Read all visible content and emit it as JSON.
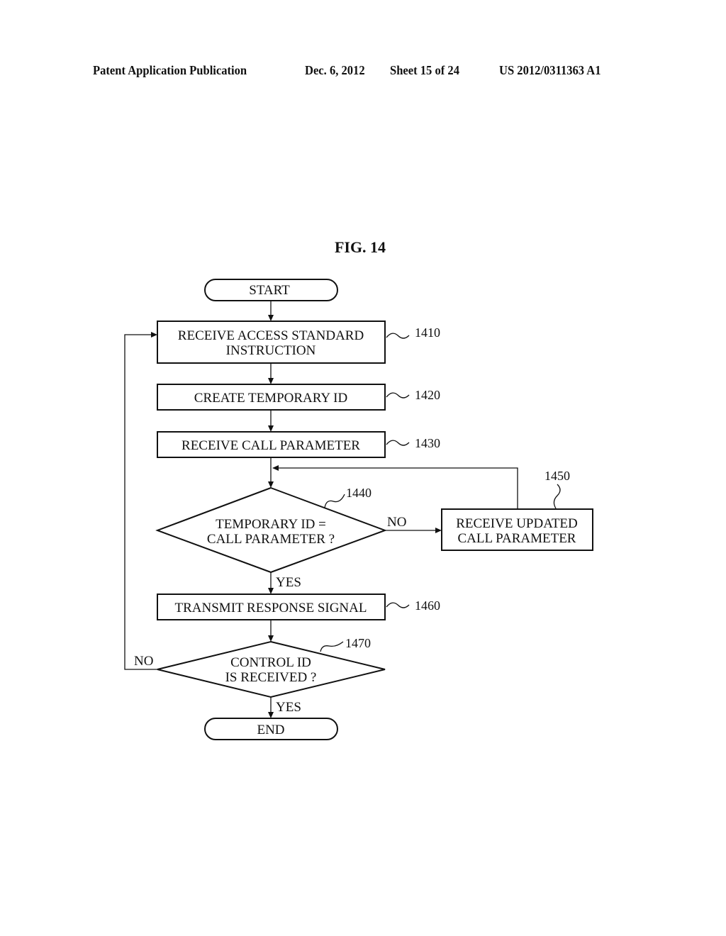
{
  "header": {
    "publication": "Patent Application Publication",
    "date": "Dec. 6, 2012",
    "sheet": "Sheet 15 of 24",
    "number": "US 2012/0311363 A1"
  },
  "figure": {
    "title": "FIG. 14",
    "nodes": {
      "start": {
        "text": "START"
      },
      "s1410": {
        "lines": [
          "RECEIVE ACCESS STANDARD",
          "INSTRUCTION"
        ],
        "ref": "1410"
      },
      "s1420": {
        "lines": [
          "CREATE TEMPORARY ID"
        ],
        "ref": "1420"
      },
      "s1430": {
        "lines": [
          "RECEIVE CALL PARAMETER"
        ],
        "ref": "1430"
      },
      "s1440": {
        "lines": [
          "TEMPORARY ID =",
          "CALL PARAMETER ?"
        ],
        "ref": "1440"
      },
      "s1450": {
        "lines": [
          "RECEIVE UPDATED",
          "CALL PARAMETER"
        ],
        "ref": "1450"
      },
      "s1460": {
        "lines": [
          "TRANSMIT RESPONSE SIGNAL"
        ],
        "ref": "1460"
      },
      "s1470": {
        "lines": [
          "CONTROL ID",
          "IS RECEIVED ?"
        ],
        "ref": "1470"
      },
      "end": {
        "text": "END"
      }
    },
    "edge_labels": {
      "d1440_no": "NO",
      "d1440_yes": "YES",
      "d1470_no": "NO",
      "d1470_yes": "YES"
    }
  }
}
